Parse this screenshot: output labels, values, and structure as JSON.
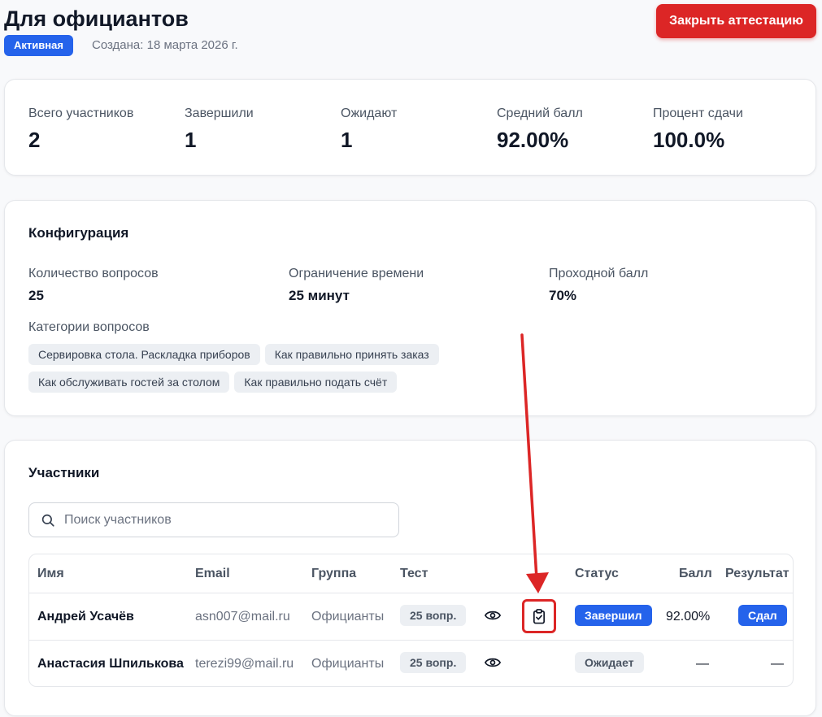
{
  "page": {
    "title": "Для официантов",
    "status_badge": "Активная",
    "created": "Создана: 18 марта 2026 г.",
    "close_button": "Закрыть аттестацию"
  },
  "stats": [
    {
      "label": "Всего участников",
      "value": "2"
    },
    {
      "label": "Завершили",
      "value": "1"
    },
    {
      "label": "Ожидают",
      "value": "1"
    },
    {
      "label": "Средний балл",
      "value": "92.00%"
    },
    {
      "label": "Процент сдачи",
      "value": "100.0%"
    }
  ],
  "config": {
    "title": "Конфигурация",
    "questions_label": "Количество вопросов",
    "questions_value": "25",
    "time_label": "Ограничение времени",
    "time_value": "25 минут",
    "pass_label": "Проходной балл",
    "pass_value": "70%",
    "categories_label": "Категории вопросов",
    "categories": [
      "Сервировка стола. Раскладка приборов",
      "Как правильно принять заказ",
      "Как обслуживать гостей за столом",
      "Как правильно подать счёт"
    ]
  },
  "participants": {
    "title": "Участники",
    "search_placeholder": "Поиск участников",
    "search_value": "",
    "columns": {
      "name": "Имя",
      "email": "Email",
      "group": "Группа",
      "test": "Тест",
      "status": "Статус",
      "score": "Балл",
      "result": "Результат"
    },
    "rows": [
      {
        "name": "Андрей Усачёв",
        "email": "asn007@mail.ru",
        "group": "Официанты",
        "test": "25 вопр.",
        "status": "Завершил",
        "score": "92.00%",
        "result": "Сдал"
      },
      {
        "name": "Анастасия Шпилькова",
        "email": "terezi99@mail.ru",
        "group": "Официанты",
        "test": "25 вопр.",
        "status": "Ожидает",
        "score": "—",
        "result": "—"
      }
    ]
  },
  "icons": {
    "search": "search-icon",
    "view": "eye-icon",
    "review": "clipboard-check-icon"
  },
  "colors": {
    "primary": "#2563eb",
    "danger": "#dc2626",
    "chip_bg": "#eceff3"
  }
}
